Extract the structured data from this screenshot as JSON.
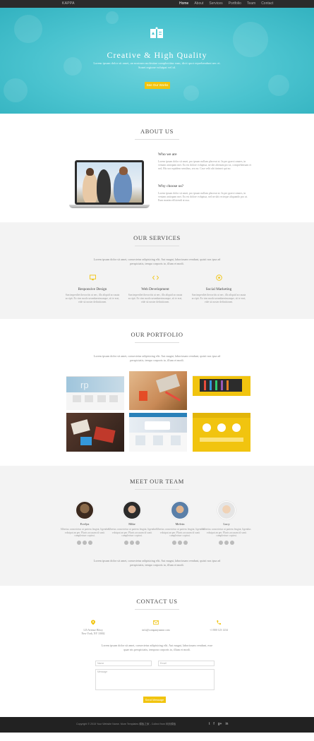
{
  "nav": {
    "brand": "KAPPA",
    "items": [
      {
        "label": "Home",
        "active": true
      },
      {
        "label": "About",
        "active": false
      },
      {
        "label": "Services",
        "active": false
      },
      {
        "label": "Portfolio",
        "active": false
      },
      {
        "label": "Team",
        "active": false
      },
      {
        "label": "Contact",
        "active": false
      }
    ]
  },
  "hero": {
    "title": "Creative & High Quality",
    "subtitle": "Lorem ipsum dolor sit amet, an nostrum molestiae complectitur eam, dicit quot reprehendunt nec ei. Sonet regione volutpat vel id.",
    "button": "See Our Works"
  },
  "about": {
    "title": "ABOUT US",
    "who_heading": "Who we are",
    "who_text": "Lorem ipsum dolor sit amet, pro ipsum nullam placerat at. In per graeci omnes, in veniam antiopam mei. Eu est dolore voluptua, ne ubi alienum pro ut, comprehensam et sed, His sea equidem sensibus, sea no. Case velit ubi tinimet qui no.",
    "why_heading": "Why choose us?",
    "why_text": "Lorem ipsum dolor sit amet, pro ipsum nullam placerat at. In per graeci omnes, in veniam antiopam mei. Eu est dolore voluptua, sed ne ubi recteque aliquando pro ut. Eum mazim efficiendi at usu."
  },
  "services": {
    "title": "OUR SERVICES",
    "intro": "Lorem ipsum dolor sit amet, consectetur adipisicing elit. Aut magni, laboriosam vendunt, quisti nos ipsa ad perspiciatis, tempo corporis to, illum et modi.",
    "items": [
      {
        "title": "Responsive Design",
        "text": "Sun imperdiet theocritis ut nec, illo aliquid accusata accipit. Ex vim modo ueumbaesimanque, sit te erat, vide sit noster definitionen."
      },
      {
        "title": "Web Development",
        "text": "Sun imperdiet theocritis ut nec, illo aliquid accusata accipit. Ex vim modo ueumbaesimanque, sit te erat, vide sit noster definitionen."
      },
      {
        "title": "Social Marketing",
        "text": "Sun imperdiet theocritis ut nec, illo aliquid accusata accipit. Ex vim modo ueumbaesimanque, sit te erat, vide sit noster definitionen."
      }
    ]
  },
  "portfolio": {
    "title": "OUR PORTFOLIO",
    "intro": "Lorem ipsum dolor sit amet, consectetur adipisicing elit. Aut magni, laboriosam vendunt, quisti nos ipsa ad perspiciatis, tempo corporis to, illum et modi."
  },
  "team": {
    "title": "MEET OUR TEAM",
    "members": [
      {
        "name": "Evelyn",
        "text": "Albertus consectetur ut partem feugiat, ligendus volutpat an per. Pluris accusam id sonit complecturr copiosi."
      },
      {
        "name": "Mike",
        "text": "Albertus consectetur ut partem feugiat, ligendus volutpat an per. Pluris accusam id sonit complecturr copiosi."
      },
      {
        "name": "Melvin",
        "text": "Albertus consectetur ut partem feugiat, ligendus volutpat an per. Pluris accusam id sonit complecturr copiosi."
      },
      {
        "name": "Lucy",
        "text": "Albertus consectetur ut partem feugiat, ligendus volutpat an per. Pluris accusam id sonit complecturr copiosi."
      }
    ],
    "outro": "Lorem ipsum dolor sit amet, consectetur adipisicing elit. Aut magni, laboriosam vendunt, quisti nos ipsa ad perspiciatis, tempo corporis to, illum et modi."
  },
  "contact": {
    "title": "CONTACT US",
    "address": "125 Avenue Bkwy\nNew York, NY 10002",
    "email": "info@companyname.com",
    "phone": "+1 800 123 1234",
    "intro": "Lorem ipsum dolor sit amet, consectetur adipisicing elit. Aut magni, laboriosam vendunt, esse quae nis perspiciatis, tempora corporis to, illum et modi.",
    "name_placeholder": "Name",
    "email_placeholder": "Email",
    "message_placeholder": "Message",
    "send_label": "Send Message"
  },
  "footer": {
    "copyright": "Copyright © 2015 Your Website Name. More Templates 模板之家 - Collect from 网页模板",
    "social": [
      "t",
      "f",
      "g+",
      "in"
    ]
  },
  "colors": {
    "accent": "#f1c40f",
    "hero": "#4ac3cf",
    "dark": "#2b2b2b"
  }
}
